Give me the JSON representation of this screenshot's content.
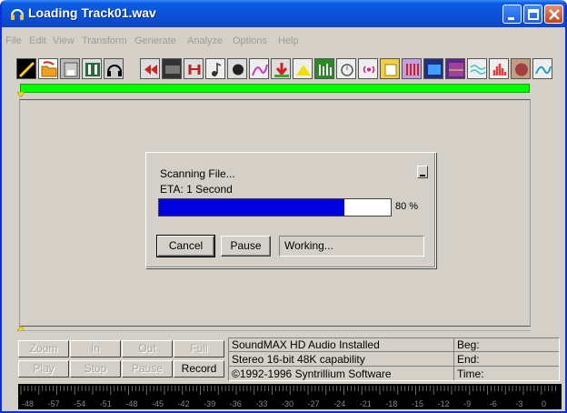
{
  "window": {
    "title": "Loading Track01.wav"
  },
  "menu": [
    "File",
    "Edit",
    "View",
    "Transform",
    "Generate",
    "Analyze",
    "Options",
    "Help"
  ],
  "toolbar": {
    "icons": [
      "waveform-icon",
      "open-folder-icon",
      "save-icon",
      "mixer-icon",
      "headphones-icon",
      "rewind-icon",
      "noise-icon",
      "loop-icon",
      "note-icon",
      "record-dot-icon",
      "spectrum-icon",
      "arrow-icon",
      "peak-icon",
      "equalizer-icon",
      "clock-icon",
      "radio-icon",
      "paste-icon",
      "bars-icon",
      "frequency-icon",
      "wave-icon",
      "histogram-icon",
      "scissors-icon",
      "curve-icon"
    ]
  },
  "dialog": {
    "line1": "Scanning File...",
    "line2": "ETA: 1 Second",
    "progress_percent": 80,
    "progress_label": "80 %",
    "cancel_label": "Cancel",
    "pause_label": "Pause",
    "status": "Working..."
  },
  "transport": {
    "row1": [
      "Zoom",
      "In",
      "Out",
      "Full"
    ],
    "row2": [
      "Play",
      "Stop",
      "Pause",
      "Record"
    ]
  },
  "info": {
    "line1": "SoundMAX HD Audio Installed",
    "line2": "Stereo 16-bit 48K capability",
    "line3": "©1992-1996 Syntrillium Software",
    "beg_label": "Beg:",
    "end_label": "End:",
    "time_label": "Time:"
  },
  "meter": {
    "labels": [
      "-48",
      "-57",
      "-54",
      "-51",
      "-48",
      "-45",
      "-42",
      "-39",
      "-36",
      "-33",
      "-30",
      "-27",
      "-24",
      "-21",
      "-18",
      "-15",
      "-12",
      "-9",
      "-6",
      "-3",
      "0"
    ]
  },
  "colors": {
    "titlebar": "#0a5ce0",
    "progress_fill": "#0000e0",
    "green_bar": "#00ff00"
  }
}
